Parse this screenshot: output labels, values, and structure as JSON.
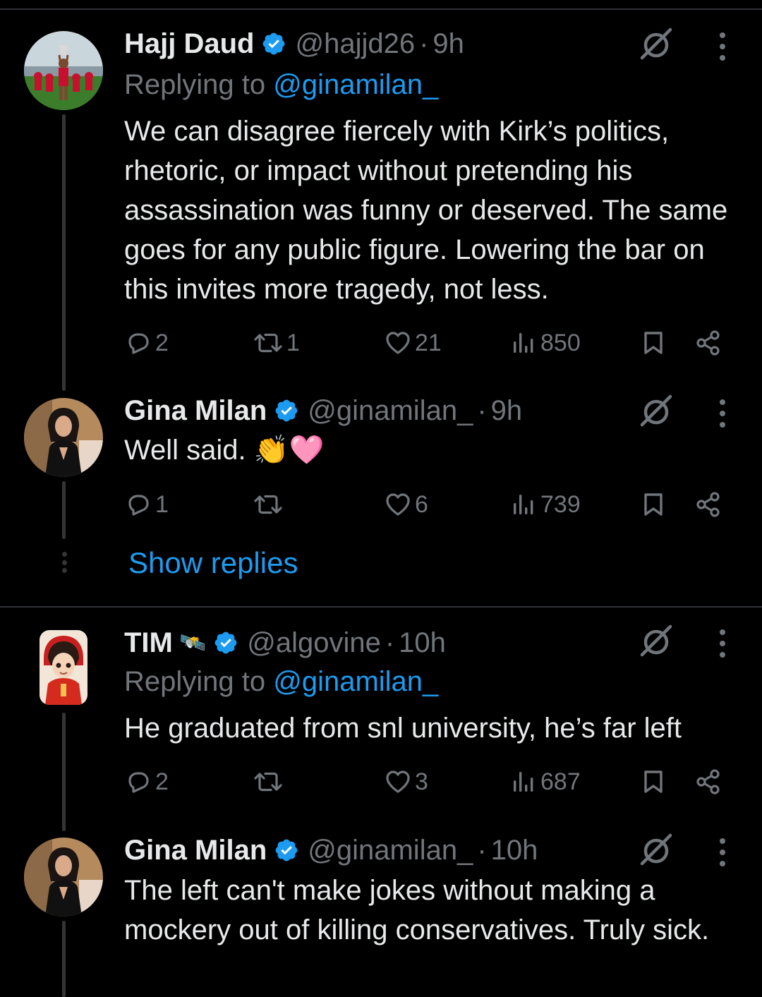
{
  "posts": [
    {
      "name": "Hajj Daud",
      "handle": "@hajjd26",
      "dot": "·",
      "time": "9h",
      "replying_prefix": "Replying to ",
      "replying_to": "@ginamilan_",
      "text": "We can disagree fiercely with Kirk’s politics, rhetoric, or impact without pretending his assassination was funny or deserved. The same goes for any public figure. Lowering the bar on this invites more tragedy, not less.",
      "replies": "2",
      "reposts": "1",
      "likes": "21",
      "views": "850"
    },
    {
      "name": "Gina Milan",
      "handle": "@ginamilan_",
      "dot": "·",
      "time": "9h",
      "text": "Well said. 👏🩷",
      "replies": "1",
      "reposts": "",
      "likes": "6",
      "views": "739"
    },
    {
      "name": "TIM",
      "name_emoji": "🛰️",
      "handle": "@algovine",
      "dot": "·",
      "time": "10h",
      "replying_prefix": "Replying to ",
      "replying_to": "@ginamilan_",
      "text": "He graduated from snl university, he’s far left",
      "replies": "2",
      "reposts": "",
      "likes": "3",
      "views": "687"
    },
    {
      "name": "Gina Milan",
      "handle": "@ginamilan_",
      "dot": "·",
      "time": "10h",
      "text": "The left can't make jokes without making a mockery out of killing conservatives. Truly sick."
    }
  ],
  "show_replies": "Show replies",
  "icons": {
    "verified": "verified-badge-icon",
    "grok": "grok-icon",
    "more": "more-icon",
    "reply": "reply-icon",
    "repost": "repost-icon",
    "like": "like-icon",
    "views": "views-icon",
    "bookmark": "bookmark-icon",
    "share": "share-icon"
  },
  "colors": {
    "background": "#000000",
    "text": "#e7e9ea",
    "muted": "#71767b",
    "accent": "#1d9bf0",
    "divider": "#2f3336"
  }
}
